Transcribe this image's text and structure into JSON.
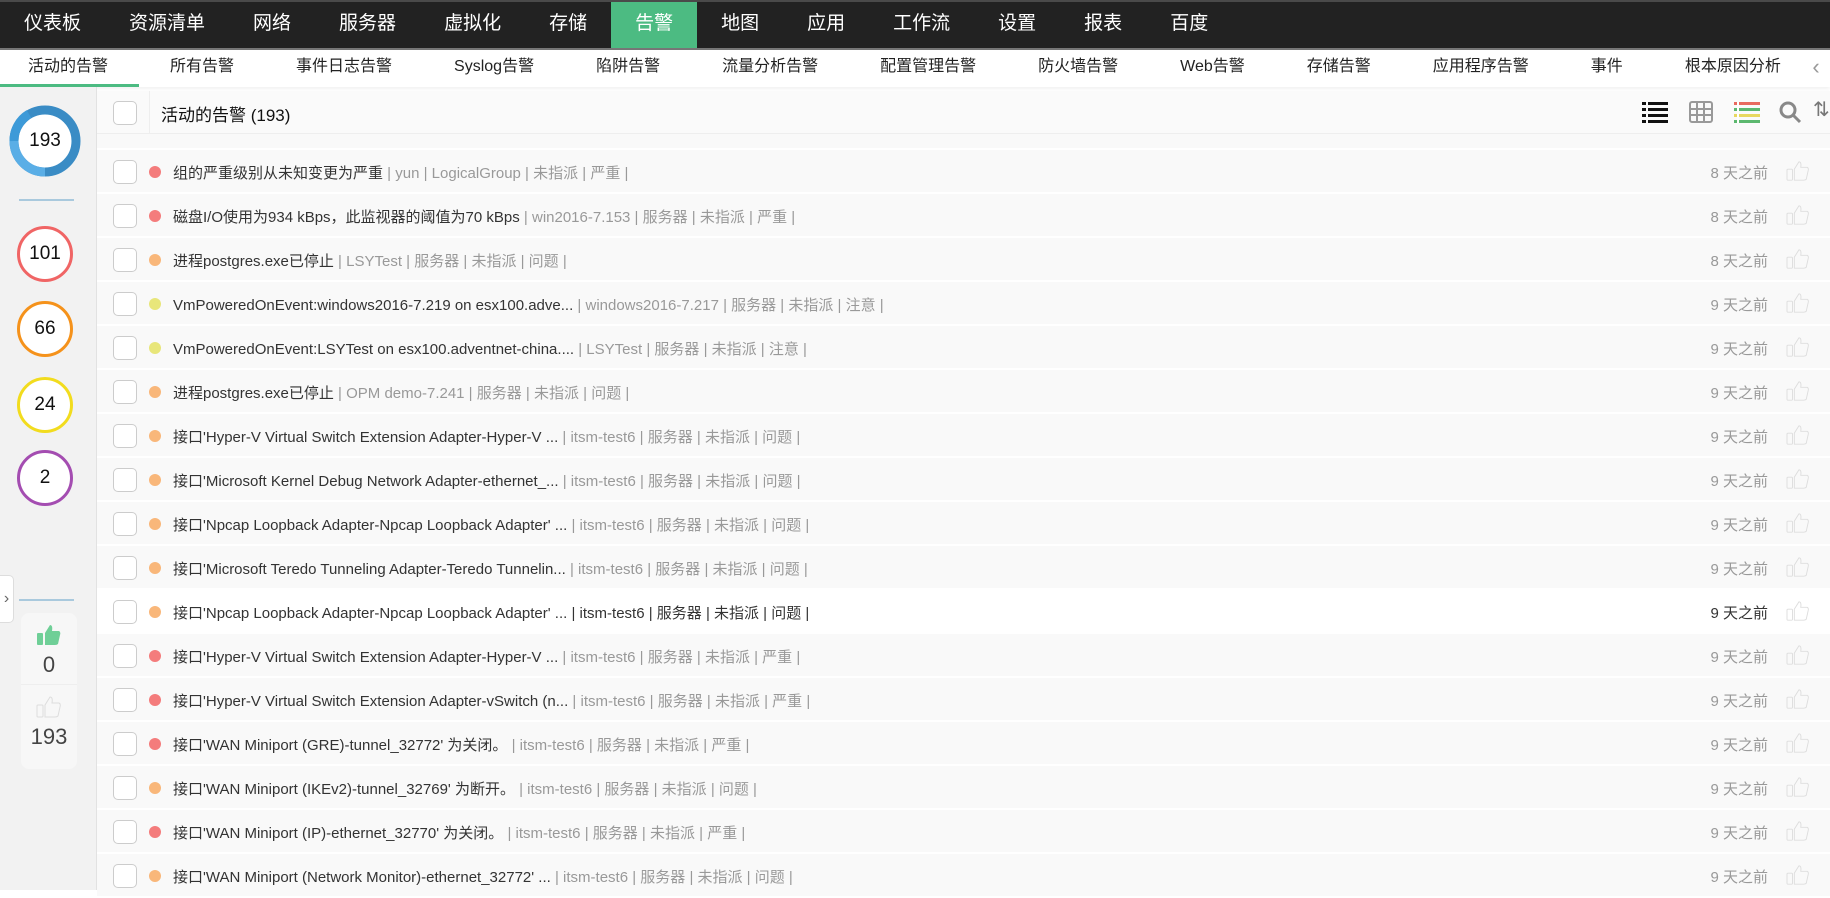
{
  "topnav": [
    "仪表板",
    "资源清单",
    "网络",
    "服务器",
    "虚拟化",
    "存储",
    "告警",
    "地图",
    "应用",
    "工作流",
    "设置",
    "报表",
    "百度"
  ],
  "topnav_active": 6,
  "subnav": [
    "活动的告警",
    "所有告警",
    "事件日志告警",
    "Syslog告警",
    "陷阱告警",
    "流量分析告警",
    "配置管理告警",
    "防火墙告警",
    "Web告警",
    "存储告警",
    "应用程序告警",
    "事件",
    "根本原因分析"
  ],
  "sidebar": {
    "total": "193",
    "critical": "101",
    "trouble": "66",
    "attention": "24",
    "other": "2",
    "likes": "0",
    "unlikes": "193"
  },
  "header": {
    "title": "活动的告警 (193)"
  },
  "colors": {
    "accent": "#4cbb82",
    "critical": "#f47c7c",
    "trouble": "#f9b77a",
    "attention": "#e8e67a"
  },
  "rows": [
    {
      "sev": "critical",
      "title": "组的严重级别从未知变更为严重",
      "meta": " | yun | LogicalGroup | 未指派 | 严重 |",
      "time": "8 天之前"
    },
    {
      "sev": "critical",
      "title": "磁盘I/O使用为934 kBps，此监视器的阈值为70 kBps",
      "meta": " | win2016-7.153 | 服务器 | 未指派 | 严重 |",
      "time": "8 天之前"
    },
    {
      "sev": "trouble",
      "title": "进程postgres.exe已停止",
      "meta": " | LSYTest | 服务器 | 未指派 | 问题 |",
      "time": "8 天之前"
    },
    {
      "sev": "attention",
      "title": "VmPoweredOnEvent:windows2016-7.219 on esx100.adve...",
      "meta": " | windows2016-7.217 | 服务器 | 未指派 | 注意 |",
      "time": "9 天之前"
    },
    {
      "sev": "attention",
      "title": "VmPoweredOnEvent:LSYTest on esx100.adventnet-china....",
      "meta": " | LSYTest | 服务器 | 未指派 | 注意 |",
      "time": "9 天之前"
    },
    {
      "sev": "trouble",
      "title": "进程postgres.exe已停止",
      "meta": " | OPM demo-7.241 | 服务器 | 未指派 | 问题 |",
      "time": "9 天之前"
    },
    {
      "sev": "trouble",
      "title": "接口'Hyper-V Virtual Switch Extension Adapter-Hyper-V ...",
      "meta": " | itsm-test6 | 服务器 | 未指派 | 问题 |",
      "time": "9 天之前"
    },
    {
      "sev": "trouble",
      "title": "接口'Microsoft Kernel Debug Network Adapter-ethernet_...",
      "meta": " | itsm-test6 | 服务器 | 未指派 | 问题 |",
      "time": "9 天之前"
    },
    {
      "sev": "trouble",
      "title": "接口'Npcap Loopback Adapter-Npcap Loopback Adapter' ...",
      "meta": " | itsm-test6 | 服务器 | 未指派 | 问题 |",
      "time": "9 天之前"
    },
    {
      "sev": "trouble",
      "title": "接口'Microsoft Teredo Tunneling Adapter-Teredo Tunnelin...",
      "meta": " | itsm-test6 | 服务器 | 未指派 | 问题 |",
      "time": "9 天之前"
    },
    {
      "sev": "trouble",
      "title": "接口'Npcap Loopback Adapter-Npcap Loopback Adapter' ...",
      "meta": " | itsm-test6 | 服务器 | 未指派 | 问题 |",
      "time": "9 天之前",
      "hover": true
    },
    {
      "sev": "critical",
      "title": "接口'Hyper-V Virtual Switch Extension Adapter-Hyper-V ...",
      "meta": " | itsm-test6 | 服务器 | 未指派 | 严重 |",
      "time": "9 天之前"
    },
    {
      "sev": "critical",
      "title": "接口'Hyper-V Virtual Switch Extension Adapter-vSwitch (n...",
      "meta": " | itsm-test6 | 服务器 | 未指派 | 严重 |",
      "time": "9 天之前"
    },
    {
      "sev": "critical",
      "title": "接口'WAN Miniport (GRE)-tunnel_32772' 为关闭。",
      "meta": " | itsm-test6 | 服务器 | 未指派 | 严重 |",
      "time": "9 天之前"
    },
    {
      "sev": "trouble",
      "title": "接口'WAN Miniport (IKEv2)-tunnel_32769' 为断开。",
      "meta": " | itsm-test6 | 服务器 | 未指派 | 问题 |",
      "time": "9 天之前"
    },
    {
      "sev": "critical",
      "title": "接口'WAN Miniport (IP)-ethernet_32770' 为关闭。",
      "meta": " | itsm-test6 | 服务器 | 未指派 | 严重 |",
      "time": "9 天之前"
    },
    {
      "sev": "trouble",
      "title": "接口'WAN Miniport (Network Monitor)-ethernet_32772' ...",
      "meta": " | itsm-test6 | 服务器 | 未指派 | 问题 |",
      "time": "9 天之前"
    }
  ]
}
